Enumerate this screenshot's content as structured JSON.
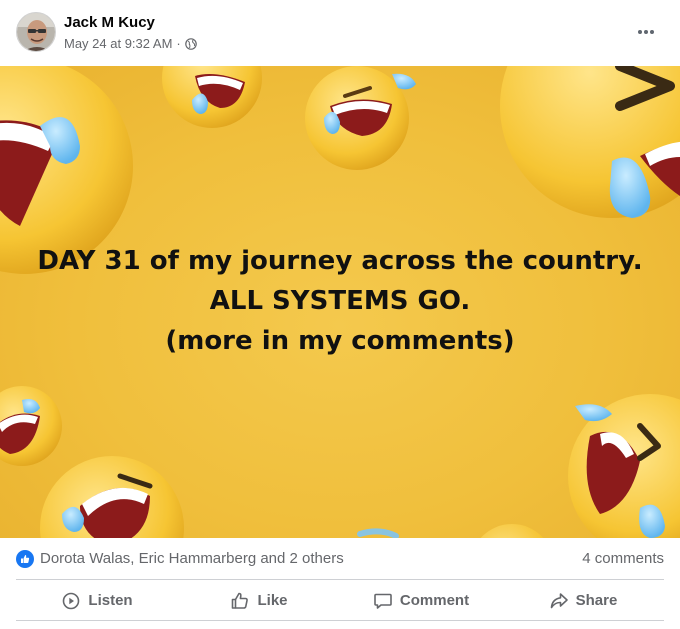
{
  "post": {
    "author": "Jack M Kucy",
    "timestamp": "May 24 at 9:32 AM",
    "separator": "·",
    "privacy_icon": "globe-icon",
    "more_icon": "more-options-icon",
    "image_text": {
      "line1": "DAY 31 of my journey across the country.",
      "line2": "ALL SYSTEMS GO.",
      "line3": "(more in my comments)"
    },
    "image_background_color": "#f0bf3c"
  },
  "stats": {
    "reactions_text": "Dorota Walas, Eric Hammarberg and 2 others",
    "reaction_icon": "like-icon",
    "comments_text": "4 comments"
  },
  "actions": [
    {
      "label": "Listen",
      "icon": "play-circle-icon"
    },
    {
      "label": "Like",
      "icon": "thumbs-up-icon"
    },
    {
      "label": "Comment",
      "icon": "comment-bubble-icon"
    },
    {
      "label": "Share",
      "icon": "share-arrow-icon"
    }
  ],
  "colors": {
    "accent": "#1877f2",
    "secondary_text": "#65676b"
  }
}
